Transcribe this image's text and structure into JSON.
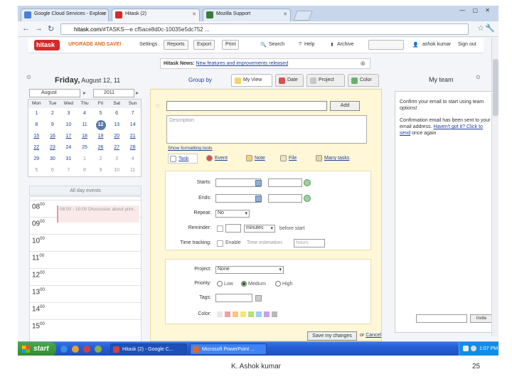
{
  "browser": {
    "tabs": [
      {
        "title": "Google Cloud Services - Explore",
        "icon_color": "#4a7fd6"
      },
      {
        "title": "Hitask (2)",
        "icon_color": "#d42a2a"
      },
      {
        "title": "Mozilla Support",
        "icon_color": "#3a7a3a"
      }
    ],
    "window_controls": "— ▢ ✕",
    "url_domain": "hitask.com",
    "url_rest": "/#TASKS—e cf5ace8d0c-10035e5dc752 ...",
    "nav": {
      "back": "←",
      "forward": "→",
      "reload": "↻"
    }
  },
  "app": {
    "logo": "hitask",
    "upgrade": "UPGRADE AND SAVE!",
    "header_buttons": [
      "Settings",
      "Reports",
      "Export",
      "Print"
    ],
    "search_label": "Search",
    "help_label": "Help",
    "archive_label": "Archive",
    "user": "ashok kumar",
    "signout": "Sign out",
    "news_label": "Hitask News:",
    "news_link": "New features and improvements released"
  },
  "left": {
    "day_name": "Friday,",
    "day_date": "August 12, 11",
    "month": "August",
    "year": "2011",
    "weekdays": [
      "Mon",
      "Tue",
      "Wed",
      "Thu",
      "Fri",
      "Sat",
      "Sun"
    ],
    "weeks": [
      [
        {
          "d": "1",
          "s": "c"
        },
        {
          "d": "2",
          "s": "c"
        },
        {
          "d": "3",
          "s": "c"
        },
        {
          "d": "4",
          "s": "c"
        },
        {
          "d": "5",
          "s": "c"
        },
        {
          "d": "6",
          "s": "c"
        },
        {
          "d": "7",
          "s": "c"
        }
      ],
      [
        {
          "d": "8",
          "s": "c"
        },
        {
          "d": "9",
          "s": "c"
        },
        {
          "d": "10",
          "s": "c"
        },
        {
          "d": "11",
          "s": "c"
        },
        {
          "d": "12",
          "s": "today"
        },
        {
          "d": "13",
          "s": "c"
        },
        {
          "d": "14",
          "s": "c"
        }
      ],
      [
        {
          "d": "15",
          "s": "w"
        },
        {
          "d": "16",
          "s": "w"
        },
        {
          "d": "17",
          "s": "w"
        },
        {
          "d": "18",
          "s": "w"
        },
        {
          "d": "19",
          "s": "w"
        },
        {
          "d": "20",
          "s": "w"
        },
        {
          "d": "21",
          "s": "w"
        }
      ],
      [
        {
          "d": "22",
          "s": "w"
        },
        {
          "d": "23",
          "s": "w"
        },
        {
          "d": "24",
          "s": "c"
        },
        {
          "d": "25",
          "s": "c"
        },
        {
          "d": "26",
          "s": "w"
        },
        {
          "d": "27",
          "s": "w"
        },
        {
          "d": "28",
          "s": "w"
        }
      ],
      [
        {
          "d": "29",
          "s": "c"
        },
        {
          "d": "30",
          "s": "c"
        },
        {
          "d": "31",
          "s": "c"
        },
        {
          "d": "1",
          "s": "o"
        },
        {
          "d": "2",
          "s": "o"
        },
        {
          "d": "3",
          "s": "o"
        },
        {
          "d": "4",
          "s": "o"
        }
      ],
      [
        {
          "d": "5",
          "s": "o"
        },
        {
          "d": "6",
          "s": "o"
        },
        {
          "d": "7",
          "s": "o"
        },
        {
          "d": "8",
          "s": "o"
        },
        {
          "d": "9",
          "s": "o"
        },
        {
          "d": "10",
          "s": "o"
        },
        {
          "d": "11",
          "s": "o"
        }
      ]
    ],
    "all_day": "All day events",
    "hours": [
      "08",
      "09",
      "10",
      "11",
      "12",
      "13",
      "14",
      "15"
    ],
    "event_text": "08:00 - 10:00 Discussion about pilot..."
  },
  "center": {
    "group_by": "Group by",
    "view_tabs": [
      "My View",
      "Date",
      "Project",
      "Color"
    ],
    "add_button": "Add",
    "description_placeholder": "Description",
    "show_formatting": "Show formatting tools",
    "types": [
      "Task",
      "Event",
      "Note",
      "File",
      "Many tasks"
    ],
    "labels": {
      "starts": "Starts:",
      "ends": "Ends:",
      "repeat": "Repeat:",
      "reminder": "Reminder:",
      "time_tracking": "Time tracking:",
      "project": "Project:",
      "priority": "Priority:",
      "tags": "Tags:",
      "color": "Color:"
    },
    "repeat_value": "No",
    "reminder_unit": "minutes",
    "reminder_suffix": "before start",
    "enable_label": "Enable",
    "time_estimation": "Time estimation:",
    "hours_placeholder": "hours",
    "project_value": "None",
    "priorities": [
      "Low",
      "Medium",
      "High"
    ],
    "priority_selected": "Medium",
    "colors": [
      "#e8e8e8",
      "#f0a0a0",
      "#f5c77a",
      "#f5e67a",
      "#b5e07a",
      "#a0d0f0",
      "#c8a0e8",
      "#b8b8b8"
    ],
    "save": "Save my changes",
    "or": "or",
    "cancel": "Cancel"
  },
  "right": {
    "title": "My team",
    "confirm_text": "Confirm your email to start using team options!",
    "confirm_sent": "Confirmation email has been sent to your email address.",
    "confirm_link": "Haven't got it? Click to send",
    "confirm_again": "once again",
    "invite_button": "Invite"
  },
  "taskbar": {
    "start": "start",
    "tasks": [
      "Hitask (2) - Google C...",
      "Microsoft PowerPoint ..."
    ],
    "clock": "1:07 PM"
  },
  "slide": {
    "author": "K. Ashok kumar",
    "page": "25"
  }
}
